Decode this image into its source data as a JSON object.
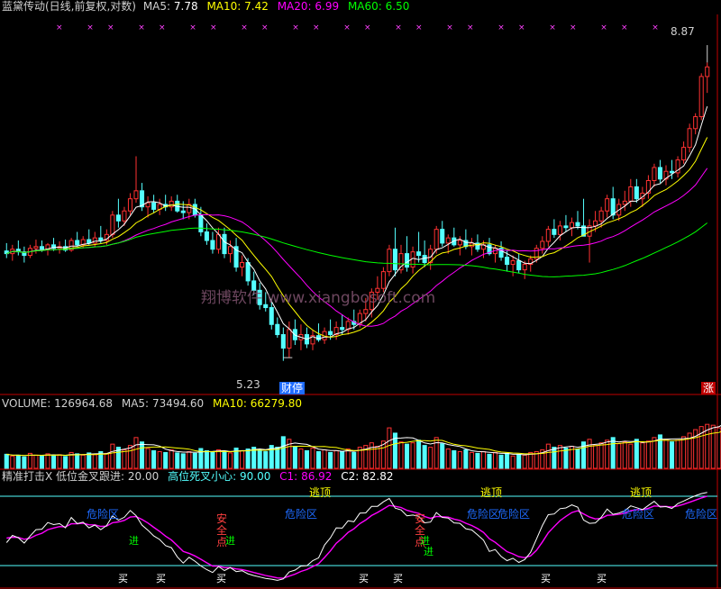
{
  "panel_main": {
    "title": "蓝黛传动(日线,前复权,对数)",
    "ma5_label": "MA5:",
    "ma5_value": "7.78",
    "ma10_label": "MA10:",
    "ma10_value": "7.42",
    "ma20_label": "MA20:",
    "ma20_value": "6.99",
    "ma60_label": "MA60:",
    "ma60_value": "6.50",
    "high_label": "8.87",
    "low_label": "5.23",
    "event_badge": "财停",
    "limit_badge": "涨",
    "watermark": "翔博软件 www.xiangbosoft.com"
  },
  "panel_volume": {
    "title": "VOLUME:",
    "value": "126964.68",
    "ma5_label": "MA5:",
    "ma5_value": "73494.60",
    "ma10_label": "MA10:",
    "ma10_value": "66279.80"
  },
  "panel_indicator": {
    "title": "精准打击X 低位金叉跟进:",
    "low_cross": "20.00",
    "high_cross_label": "高位死叉小心:",
    "high_cross": "90.00",
    "c1_label": "C1:",
    "c1_value": "86.92",
    "c2_label": "C2:",
    "c2_value": "82.82",
    "zone_labels": [
      "危险区",
      "危险区",
      "危险区",
      "危险区",
      "危险区",
      "危险区"
    ],
    "top_labels": [
      "逃顶",
      "逃顶",
      "逃顶"
    ],
    "safe_labels": [
      "安全点",
      "安全点"
    ],
    "green_labels": [
      "进",
      "进",
      "进",
      "进"
    ],
    "buy_labels": [
      "买",
      "买",
      "买",
      "买",
      "买",
      "买",
      "买"
    ]
  },
  "colors": {
    "up": "#ff3232",
    "down": "#54ffff",
    "ma5": "#ffffff",
    "ma10": "#ffff00",
    "ma20": "#ff00ff",
    "ma60": "#00ff00",
    "axis": "#c00000",
    "zone": "#1e6bff",
    "marker": "#ff40ff"
  },
  "chart_data": {
    "type": "candlestick",
    "scale": "log",
    "ylim": [
      5.0,
      9.3
    ],
    "candles": [
      [
        6.33,
        6.42,
        6.25,
        6.3
      ],
      [
        6.3,
        6.4,
        6.22,
        6.35
      ],
      [
        6.35,
        6.45,
        6.28,
        6.32
      ],
      [
        6.32,
        6.38,
        6.2,
        6.28
      ],
      [
        6.28,
        6.4,
        6.25,
        6.36
      ],
      [
        6.36,
        6.46,
        6.3,
        6.38
      ],
      [
        6.38,
        6.45,
        6.32,
        6.35
      ],
      [
        6.35,
        6.42,
        6.28,
        6.4
      ],
      [
        6.4,
        6.48,
        6.33,
        6.36
      ],
      [
        6.36,
        6.44,
        6.3,
        6.38
      ],
      [
        6.38,
        6.46,
        6.32,
        6.34
      ],
      [
        6.34,
        6.48,
        6.32,
        6.45
      ],
      [
        6.45,
        6.55,
        6.38,
        6.4
      ],
      [
        6.4,
        6.5,
        6.36,
        6.46
      ],
      [
        6.46,
        6.58,
        6.4,
        6.42
      ],
      [
        6.42,
        6.55,
        6.38,
        6.48
      ],
      [
        6.48,
        6.62,
        6.42,
        6.45
      ],
      [
        6.45,
        6.58,
        6.4,
        6.52
      ],
      [
        6.52,
        6.8,
        6.48,
        6.75
      ],
      [
        6.75,
        6.95,
        6.6,
        6.68
      ],
      [
        6.68,
        6.85,
        6.62,
        6.8
      ],
      [
        6.8,
        7.02,
        6.75,
        6.95
      ],
      [
        6.95,
        7.5,
        6.9,
        7.05
      ],
      [
        7.05,
        7.15,
        6.8,
        6.85
      ],
      [
        6.85,
        6.98,
        6.72,
        6.9
      ],
      [
        6.9,
        7.0,
        6.78,
        6.82
      ],
      [
        6.82,
        6.95,
        6.75,
        6.88
      ],
      [
        6.88,
        7.0,
        6.8,
        6.85
      ],
      [
        6.85,
        6.98,
        6.8,
        6.92
      ],
      [
        6.92,
        7.0,
        6.78,
        6.8
      ],
      [
        6.8,
        6.92,
        6.7,
        6.78
      ],
      [
        6.78,
        6.95,
        6.7,
        6.88
      ],
      [
        6.88,
        6.95,
        6.72,
        6.75
      ],
      [
        6.75,
        6.85,
        6.5,
        6.55
      ],
      [
        6.55,
        6.65,
        6.4,
        6.45
      ],
      [
        6.45,
        6.55,
        6.3,
        6.35
      ],
      [
        6.35,
        6.6,
        6.3,
        6.52
      ],
      [
        6.52,
        6.6,
        6.25,
        6.3
      ],
      [
        6.3,
        6.45,
        6.2,
        6.38
      ],
      [
        6.38,
        6.48,
        6.1,
        6.15
      ],
      [
        6.15,
        6.28,
        6.05,
        6.2
      ],
      [
        6.2,
        6.25,
        5.95,
        6.0
      ],
      [
        6.0,
        6.1,
        5.85,
        5.9
      ],
      [
        5.9,
        5.98,
        5.7,
        5.75
      ],
      [
        5.75,
        5.88,
        5.68,
        5.72
      ],
      [
        5.72,
        5.8,
        5.5,
        5.55
      ],
      [
        5.55,
        5.62,
        5.42,
        5.45
      ],
      [
        5.45,
        5.52,
        5.2,
        5.32
      ],
      [
        5.32,
        5.58,
        5.23,
        5.5
      ],
      [
        5.5,
        5.6,
        5.35,
        5.4
      ],
      [
        5.4,
        5.55,
        5.3,
        5.45
      ],
      [
        5.45,
        5.52,
        5.32,
        5.36
      ],
      [
        5.36,
        5.5,
        5.3,
        5.44
      ],
      [
        5.44,
        5.56,
        5.38,
        5.4
      ],
      [
        5.4,
        5.52,
        5.36,
        5.48
      ],
      [
        5.48,
        5.6,
        5.4,
        5.45
      ],
      [
        5.45,
        5.58,
        5.4,
        5.52
      ],
      [
        5.52,
        5.65,
        5.45,
        5.5
      ],
      [
        5.5,
        5.62,
        5.45,
        5.58
      ],
      [
        5.58,
        5.7,
        5.5,
        5.55
      ],
      [
        5.55,
        5.7,
        5.52,
        5.66
      ],
      [
        5.66,
        5.82,
        5.58,
        5.7
      ],
      [
        5.7,
        5.92,
        5.62,
        5.88
      ],
      [
        5.88,
        6.05,
        5.8,
        5.92
      ],
      [
        5.92,
        6.15,
        5.88,
        6.1
      ],
      [
        6.1,
        6.4,
        6.05,
        6.35
      ],
      [
        6.35,
        6.6,
        6.05,
        6.12
      ],
      [
        6.12,
        6.4,
        6.08,
        6.3
      ],
      [
        6.3,
        6.5,
        6.1,
        6.15
      ],
      [
        6.15,
        6.38,
        6.08,
        6.32
      ],
      [
        6.32,
        6.55,
        6.2,
        6.28
      ],
      [
        6.28,
        6.45,
        6.15,
        6.2
      ],
      [
        6.2,
        6.4,
        6.12,
        6.35
      ],
      [
        6.35,
        6.62,
        6.3,
        6.58
      ],
      [
        6.58,
        6.68,
        6.38,
        6.42
      ],
      [
        6.42,
        6.52,
        6.3,
        6.48
      ],
      [
        6.48,
        6.6,
        6.38,
        6.4
      ],
      [
        6.4,
        6.5,
        6.28,
        6.45
      ],
      [
        6.45,
        6.58,
        6.35,
        6.38
      ],
      [
        6.38,
        6.48,
        6.28,
        6.42
      ],
      [
        6.42,
        6.52,
        6.32,
        6.35
      ],
      [
        6.35,
        6.45,
        6.25,
        6.4
      ],
      [
        6.4,
        6.48,
        6.28,
        6.3
      ],
      [
        6.3,
        6.4,
        6.2,
        6.36
      ],
      [
        6.36,
        6.44,
        6.22,
        6.26
      ],
      [
        6.26,
        6.34,
        6.1,
        6.18
      ],
      [
        6.18,
        6.28,
        6.05,
        6.22
      ],
      [
        6.22,
        6.3,
        6.08,
        6.12
      ],
      [
        6.12,
        6.22,
        6.02,
        6.18
      ],
      [
        6.18,
        6.28,
        6.1,
        6.24
      ],
      [
        6.24,
        6.4,
        6.2,
        6.36
      ],
      [
        6.36,
        6.5,
        6.3,
        6.44
      ],
      [
        6.44,
        6.62,
        6.38,
        6.58
      ],
      [
        6.58,
        6.7,
        6.48,
        6.52
      ],
      [
        6.52,
        6.68,
        6.45,
        6.62
      ],
      [
        6.62,
        6.75,
        6.55,
        6.6
      ],
      [
        6.6,
        6.72,
        6.5,
        6.66
      ],
      [
        6.66,
        6.8,
        6.58,
        6.62
      ],
      [
        6.62,
        6.95,
        6.55,
        6.5
      ],
      [
        6.5,
        6.7,
        6.2,
        6.62
      ],
      [
        6.62,
        6.8,
        6.55,
        6.68
      ],
      [
        6.68,
        6.85,
        6.6,
        6.8
      ],
      [
        6.8,
        7.0,
        6.72,
        6.95
      ],
      [
        6.95,
        7.1,
        6.7,
        6.75
      ],
      [
        6.75,
        6.95,
        6.68,
        6.88
      ],
      [
        6.88,
        7.05,
        6.8,
        6.92
      ],
      [
        6.92,
        7.2,
        6.85,
        7.1
      ],
      [
        7.1,
        7.2,
        6.9,
        6.95
      ],
      [
        6.95,
        7.1,
        6.85,
        7.02
      ],
      [
        7.02,
        7.25,
        6.95,
        7.18
      ],
      [
        7.18,
        7.4,
        7.1,
        7.35
      ],
      [
        7.35,
        7.45,
        7.15,
        7.2
      ],
      [
        7.2,
        7.38,
        7.12,
        7.3
      ],
      [
        7.3,
        7.45,
        7.2,
        7.28
      ],
      [
        7.28,
        7.5,
        7.22,
        7.45
      ],
      [
        7.45,
        7.7,
        7.4,
        7.62
      ],
      [
        7.62,
        7.95,
        7.55,
        7.88
      ],
      [
        7.88,
        8.1,
        7.8,
        8.05
      ],
      [
        8.05,
        8.7,
        8.0,
        8.65
      ],
      [
        8.65,
        8.87,
        8.4,
        8.8
      ]
    ],
    "volume": {
      "value": 126964.68,
      "bars": [
        32,
        28,
        30,
        26,
        34,
        30,
        28,
        33,
        29,
        31,
        27,
        36,
        33,
        30,
        35,
        31,
        38,
        34,
        55,
        48,
        42,
        52,
        70,
        60,
        45,
        40,
        38,
        36,
        42,
        35,
        33,
        38,
        34,
        45,
        40,
        36,
        42,
        38,
        35,
        46,
        40,
        44,
        48,
        42,
        38,
        52,
        48,
        72,
        66,
        50,
        44,
        40,
        46,
        38,
        42,
        36,
        40,
        38,
        44,
        36,
        48,
        52,
        58,
        50,
        62,
        92,
        80,
        60,
        55,
        58,
        64,
        52,
        48,
        70,
        56,
        44,
        40,
        38,
        42,
        36,
        34,
        38,
        32,
        36,
        30,
        34,
        28,
        32,
        30,
        36,
        38,
        42,
        55,
        48,
        52,
        46,
        50,
        44,
        60,
        66,
        52,
        58,
        64,
        70,
        56,
        60,
        55,
        66,
        58,
        62,
        70,
        76,
        66,
        60,
        64,
        72,
        80,
        88,
        95,
        100,
        98,
        92,
        127
      ]
    },
    "indicator": {
      "ylim": [
        0,
        100
      ],
      "levels": [
        20,
        90
      ],
      "c1_value": 86.92,
      "c2_value": 82.82
    }
  }
}
